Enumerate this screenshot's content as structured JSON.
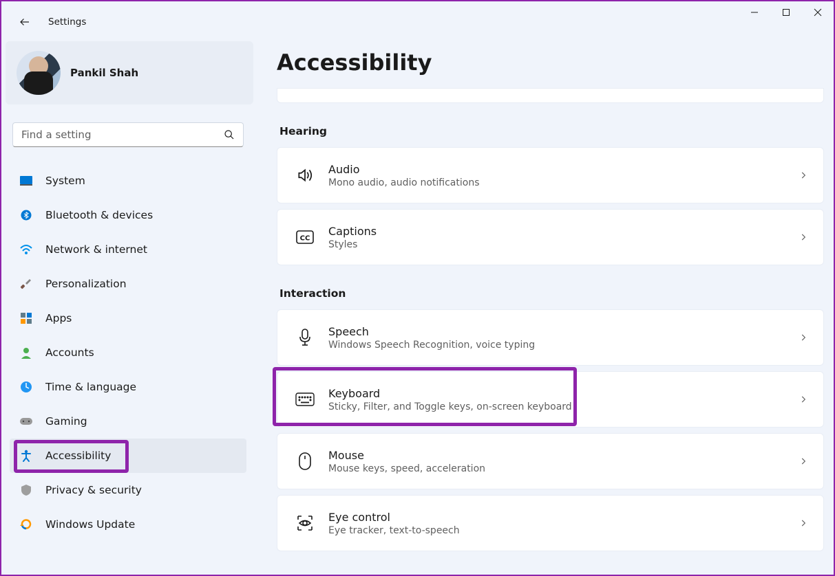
{
  "app_title": "Settings",
  "user": {
    "name": "Pankil Shah"
  },
  "search": {
    "placeholder": "Find a setting"
  },
  "sidebar": {
    "items": [
      {
        "label": "System",
        "icon": "system"
      },
      {
        "label": "Bluetooth & devices",
        "icon": "bluetooth"
      },
      {
        "label": "Network & internet",
        "icon": "network"
      },
      {
        "label": "Personalization",
        "icon": "personalization"
      },
      {
        "label": "Apps",
        "icon": "apps"
      },
      {
        "label": "Accounts",
        "icon": "accounts"
      },
      {
        "label": "Time & language",
        "icon": "timelang"
      },
      {
        "label": "Gaming",
        "icon": "gaming"
      },
      {
        "label": "Accessibility",
        "icon": "accessibility",
        "selected": true
      },
      {
        "label": "Privacy & security",
        "icon": "privacy"
      },
      {
        "label": "Windows Update",
        "icon": "update"
      }
    ]
  },
  "page": {
    "title": "Accessibility",
    "sections": [
      {
        "header": "Hearing",
        "items": [
          {
            "title": "Audio",
            "sub": "Mono audio, audio notifications",
            "icon": "audio"
          },
          {
            "title": "Captions",
            "sub": "Styles",
            "icon": "captions"
          }
        ]
      },
      {
        "header": "Interaction",
        "items": [
          {
            "title": "Speech",
            "sub": "Windows Speech Recognition, voice typing",
            "icon": "speech"
          },
          {
            "title": "Keyboard",
            "sub": "Sticky, Filter, and Toggle keys, on-screen keyboard",
            "icon": "keyboard",
            "highlighted": true
          },
          {
            "title": "Mouse",
            "sub": "Mouse keys, speed, acceleration",
            "icon": "mouse"
          },
          {
            "title": "Eye control",
            "sub": "Eye tracker, text-to-speech",
            "icon": "eye"
          }
        ]
      }
    ]
  }
}
